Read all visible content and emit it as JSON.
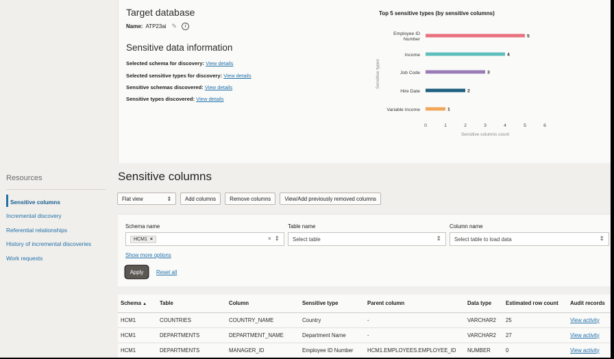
{
  "target_db": {
    "heading": "Target database",
    "name_label": "Name:",
    "name_value": "ATP23ai",
    "pencil_icon": "pencil-icon",
    "info_icon": "info-icon",
    "info_glyph": "i"
  },
  "sensitive_info": {
    "heading": "Sensitive data information",
    "lines": [
      {
        "label": "Selected schema for discovery:",
        "link": "View details"
      },
      {
        "label": "Selected sensitive types for discovery:",
        "link": "View details"
      },
      {
        "label": "Sensitive schemas discovered:",
        "link": "View details"
      },
      {
        "label": "Sensitive types discovered:",
        "link": "View details"
      }
    ]
  },
  "chart_data": {
    "type": "bar",
    "orientation": "horizontal",
    "title": "Top 5 sensitive types (by sensitive columns)",
    "xlabel": "Sensitive columns count",
    "ylabel": "Sensitive types",
    "categories": [
      "Employee ID Number",
      "Income",
      "Job Code",
      "Hire Date",
      "Variable Income"
    ],
    "category_lines": [
      [
        "Employee ID",
        "Number"
      ],
      [
        "Income"
      ],
      [
        "Job Code"
      ],
      [
        "Hire Date"
      ],
      [
        "Variable Income"
      ]
    ],
    "values": [
      5,
      4,
      3,
      2,
      1
    ],
    "colors": [
      "#e8707f",
      "#5ebfbd",
      "#9b7bb5",
      "#1f5f80",
      "#f0a75a"
    ],
    "xlim": [
      0,
      6
    ],
    "xticks": [
      "0",
      "1",
      "2",
      "3",
      "4",
      "5",
      "6"
    ],
    "grid": false
  },
  "resources": {
    "title": "Resources",
    "items": [
      {
        "label": "Sensitive columns",
        "active": true
      },
      {
        "label": "Incremental discovery",
        "active": false
      },
      {
        "label": "Referential relationships",
        "active": false
      },
      {
        "label": "History of incremental discoveries",
        "active": false
      },
      {
        "label": "Work requests",
        "active": false
      }
    ]
  },
  "sensitive_columns": {
    "heading": "Sensitive columns",
    "view_select": "Flat view",
    "add_columns": "Add columns",
    "remove_columns": "Remove columns",
    "view_removed": "View/Add previously removed columns"
  },
  "filters": {
    "schema_label": "Schema name",
    "schema_chip": "HCM1",
    "chip_remove": "×",
    "clear_glyph": "×",
    "table_label": "Table name",
    "table_placeholder": "Select table",
    "column_label": "Column name",
    "column_placeholder": "Select table to load data",
    "more_options": "Show more options",
    "apply": "Apply",
    "reset": "Reset all"
  },
  "table": {
    "headers": [
      "Schema",
      "Table",
      "Column",
      "Sensitive type",
      "Parent column",
      "Data type",
      "Estimated row count",
      "Audit records"
    ],
    "sort_glyph": "▲",
    "rows": [
      [
        "HCM1",
        "COUNTRIES",
        "COUNTRY_NAME",
        "Country",
        "-",
        "VARCHAR2",
        "25",
        "View activity"
      ],
      [
        "HCM1",
        "DEPARTMENTS",
        "DEPARTMENT_NAME",
        "Department Name",
        "-",
        "VARCHAR2",
        "27",
        "View activity"
      ],
      [
        "HCM1",
        "DEPARTMENTS",
        "MANAGER_ID",
        "Employee ID Number",
        "HCM1.EMPLOYEES.EMPLOYEE_ID",
        "NUMBER",
        "0",
        "View activity"
      ]
    ]
  }
}
